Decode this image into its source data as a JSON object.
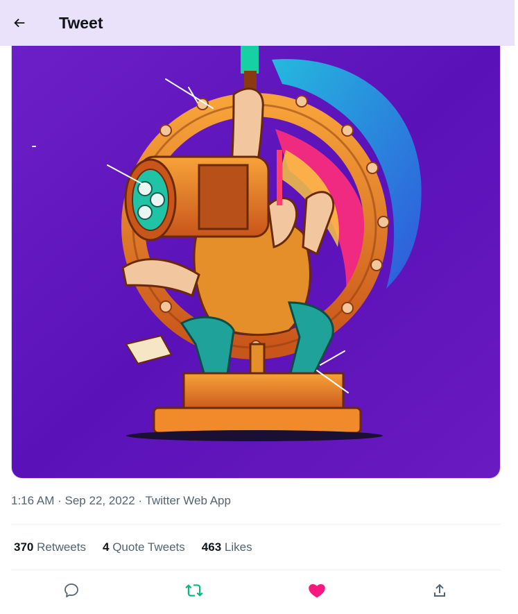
{
  "header": {
    "title": "Tweet",
    "back_icon": "arrow-left-icon"
  },
  "media": {
    "alt": "Illustration of a figure with a film-reel head seated on a golden trophy base, holding a torch"
  },
  "tweet": {
    "time": "1:16 AM",
    "date": "Sep 22, 2022",
    "source": "Twitter Web App",
    "sep": "·"
  },
  "stats": {
    "retweets_count": "370",
    "retweets_label": "Retweets",
    "quotes_count": "4",
    "quotes_label": "Quote Tweets",
    "likes_count": "463",
    "likes_label": "Likes"
  },
  "actions": {
    "reply_icon": "speech-bubble-icon",
    "retweet_icon": "retweet-icon",
    "like_icon": "heart-icon",
    "share_icon": "share-upload-icon",
    "retweet_active_color": "#00ba7c",
    "like_active_color": "#f91880"
  }
}
